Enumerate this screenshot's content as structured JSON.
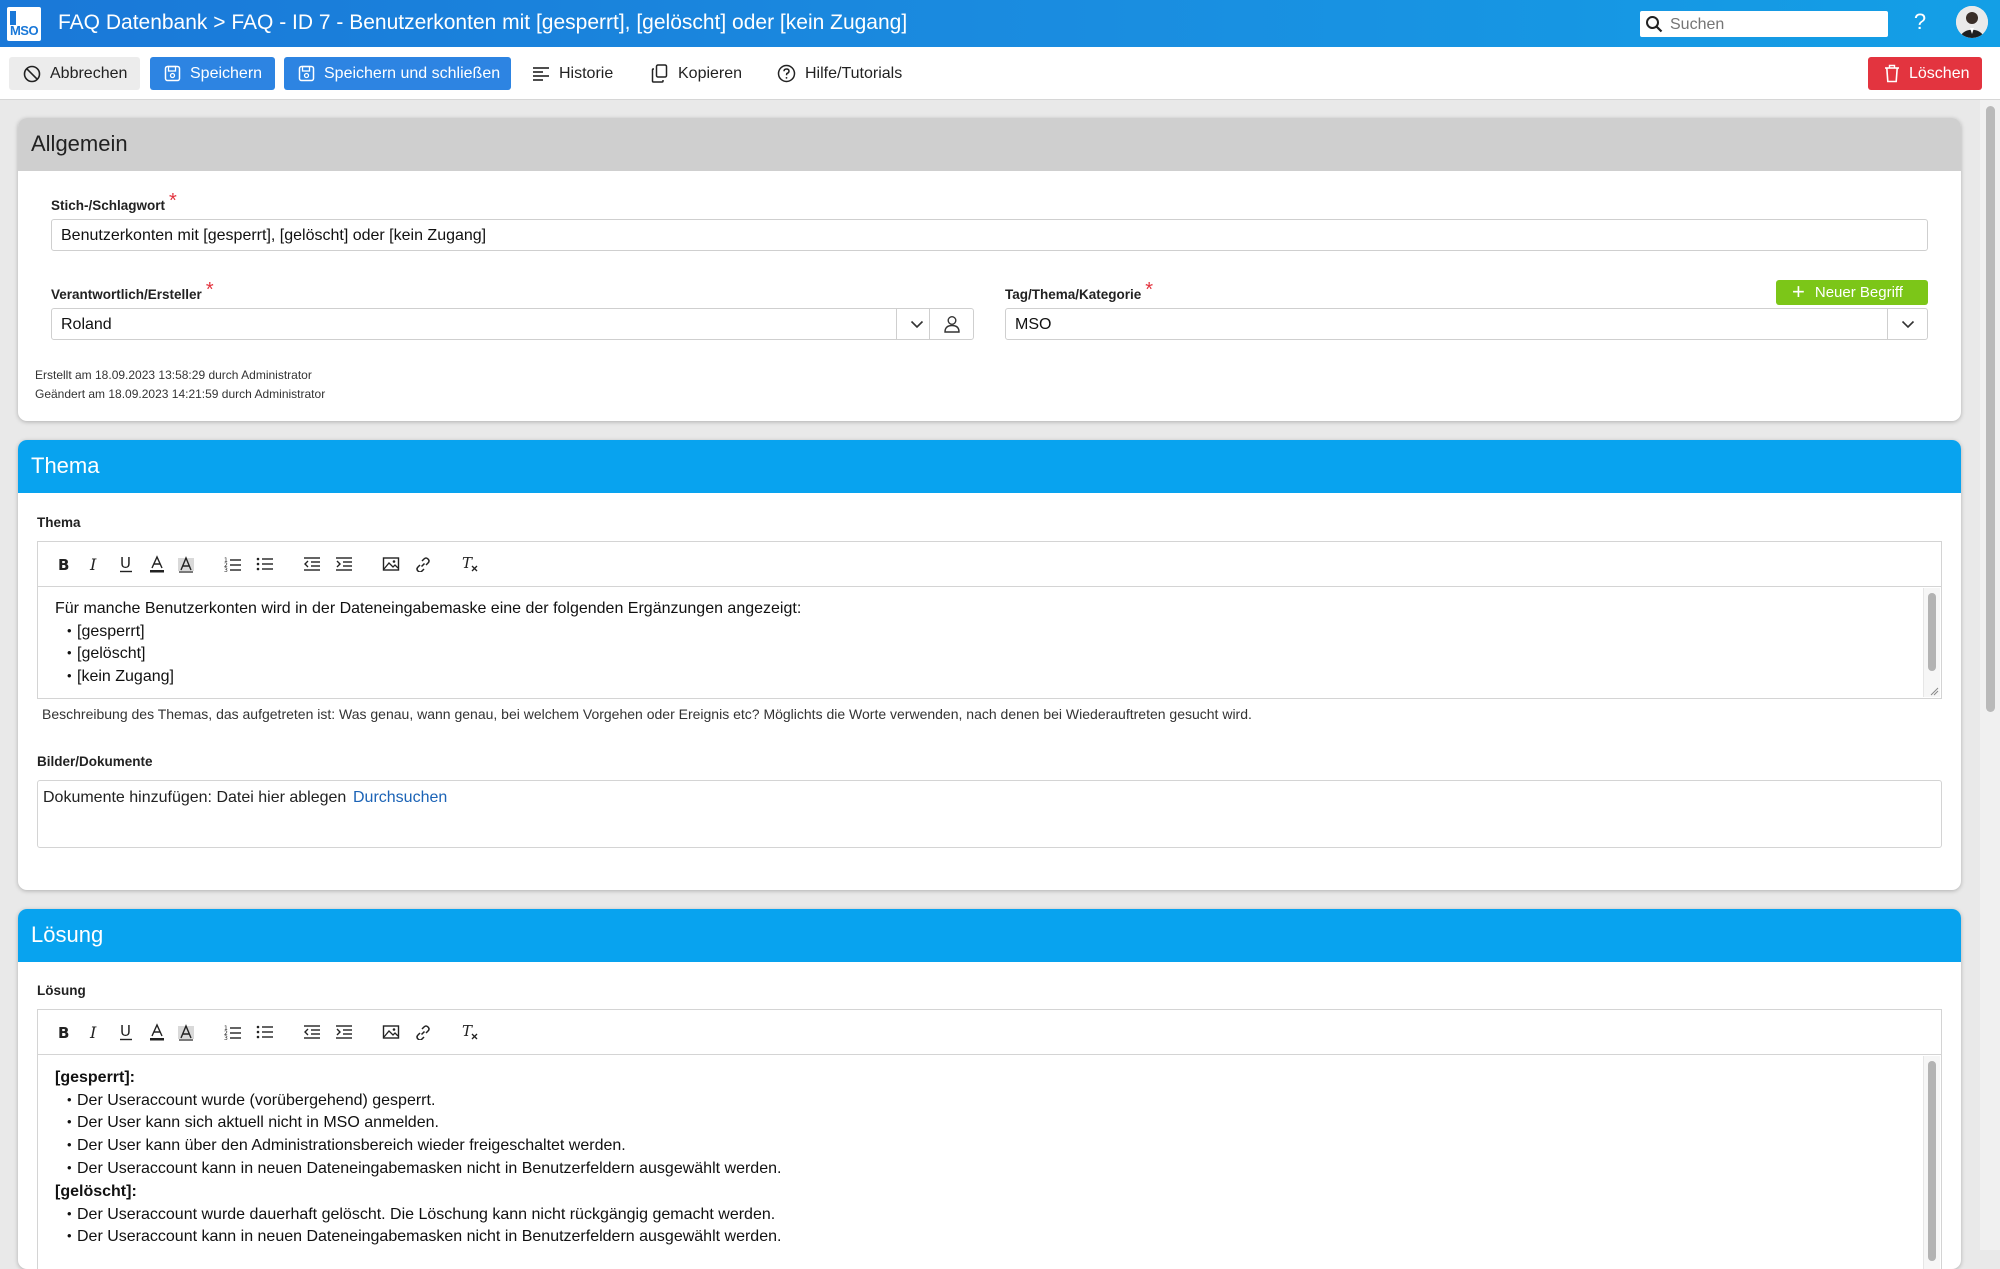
{
  "titlebar": {
    "logo_text": "MSO",
    "title": "FAQ Datenbank > FAQ - ID 7 - Benutzerkonten mit [gesperrt], [gelöscht] oder [kein Zugang]",
    "search_placeholder": "Suchen",
    "help_label": "?"
  },
  "toolbar": {
    "cancel": "Abbrechen",
    "save": "Speichern",
    "save_close": "Speichern und schließen",
    "history": "Historie",
    "copy": "Kopieren",
    "help": "Hilfe/Tutorials",
    "delete": "Löschen"
  },
  "allgemein": {
    "header": "Allgemein",
    "keyword_label": "Stich-/Schlagwort",
    "keyword_value": "Benutzerkonten mit [gesperrt], [gelöscht] oder [kein Zugang]",
    "owner_label": "Verantwortlich/Ersteller",
    "owner_value": "Roland",
    "tag_label": "Tag/Thema/Kategorie",
    "tag_value": "MSO",
    "new_term": "Neuer Begriff",
    "created": "Erstellt am 18.09.2023 13:58:29 durch Administrator",
    "changed": "Geändert am 18.09.2023 14:21:59 durch Administrator",
    "required_mark": "*"
  },
  "thema": {
    "header": "Thema",
    "label": "Thema",
    "intro": "Für manche Benutzerkonten wird in der Dateneingabemaske eine der folgenden Ergänzungen angezeigt:",
    "items": [
      "[gesperrt]",
      "[gelöscht]",
      "[kein Zugang]"
    ],
    "hint": "Beschreibung des Themas, das aufgetreten ist: Was genau, wann genau, bei welchem Vorgehen oder Ereignis etc? Möglichts die Worte verwenden, nach denen bei Wiederauftreten gesucht wird.",
    "docs_label": "Bilder/Dokumente",
    "docs_text": "Dokumente hinzufügen: Datei hier ablegen",
    "docs_link": "Durchsuchen"
  },
  "loesung": {
    "header": "Lösung",
    "label": "Lösung",
    "section1_title": "[gesperrt]:",
    "section1_items": [
      "Der Useraccount wurde (vorübergehend) gesperrt.",
      "Der User kann sich aktuell nicht in MSO anmelden.",
      "Der User kann über den Administrationsbereich wieder freigeschaltet werden.",
      "Der Useraccount kann in neuen Dateneingabemasken nicht in Benutzerfeldern ausgewählt werden."
    ],
    "section2_title": "[gelöscht]:",
    "section2_items": [
      "Der Useraccount wurde dauerhaft gelöscht. Die Löschung kann nicht rückgängig gemacht werden.",
      "Der Useraccount kann in neuen Dateneingabemasken nicht in Benutzerfeldern ausgewählt werden."
    ]
  },
  "editor": {
    "bullet": "•",
    "icons": [
      "bold-icon",
      "italic-icon",
      "underline-icon",
      "font-color-icon",
      "highlight-icon",
      "ordered-list-icon",
      "unordered-list-icon",
      "outdent-icon",
      "indent-icon",
      "image-icon",
      "link-icon",
      "clear-format-icon"
    ]
  },
  "colors": {
    "titlebar": "#1a78d8",
    "primary_button": "#2d84e2",
    "delete_button": "#e3343f",
    "new_term_button": "#7cc618",
    "panel_header_blue": "#08a3ef",
    "panel_header_gray": "#cfcfcf",
    "link": "#1b63b6"
  }
}
